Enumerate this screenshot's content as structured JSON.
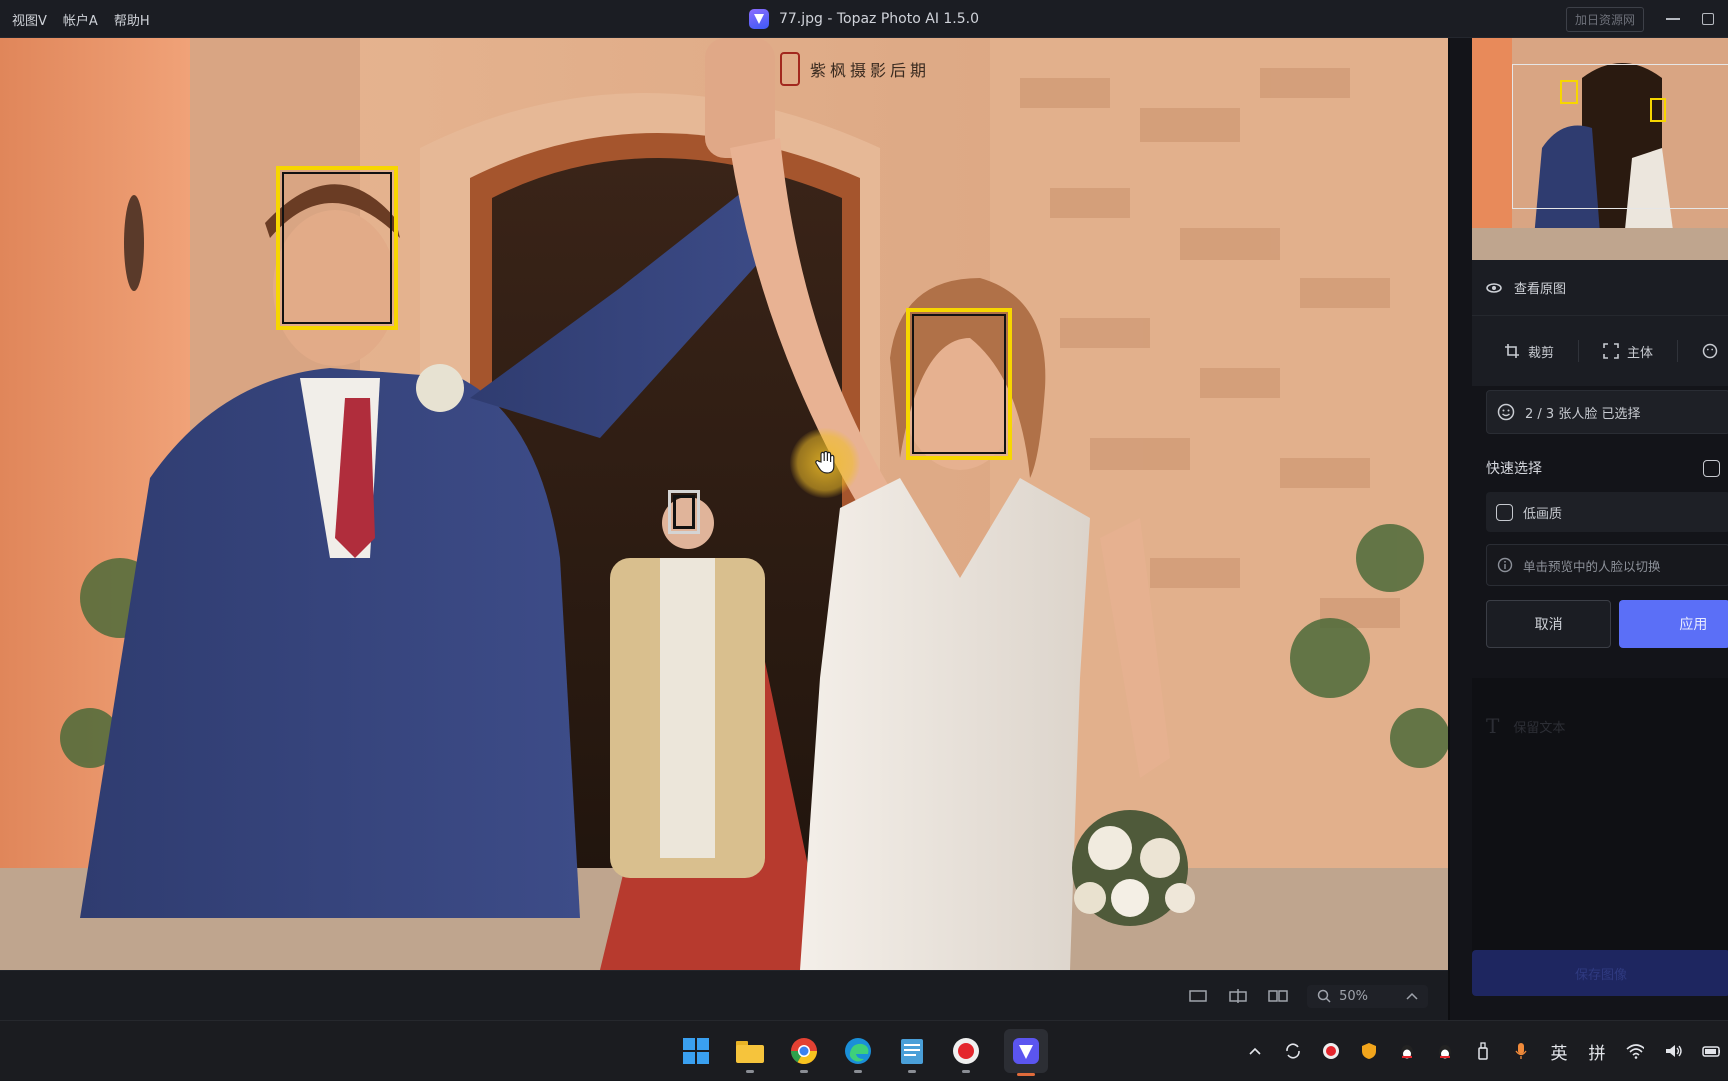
{
  "menu": {
    "items": [
      "视图V",
      "帐户A",
      "帮助H"
    ]
  },
  "window": {
    "title": "77.jpg - Topaz Photo AI 1.5.0",
    "watermark_button": "加日资源网"
  },
  "photo": {
    "watermark_text": "紫枫摄影后期"
  },
  "bottom_toolbar": {
    "zoom_label": "50%"
  },
  "panel": {
    "view_original": "查看原图",
    "tabs": [
      {
        "label": "裁剪"
      },
      {
        "label": "主体"
      }
    ],
    "face_count": "2 / 3 张人脸 已选择",
    "quick_select": "快速选择",
    "low_quality": "低画质",
    "hint": "单击预览中的人脸以切换",
    "cancel": "取消",
    "apply": "应用",
    "keep_text": "保留文本",
    "save": "保存图像"
  },
  "colors": {
    "accent": "#5b6ff7",
    "face_box": "#f7d600",
    "panel_bg": "#131419"
  }
}
